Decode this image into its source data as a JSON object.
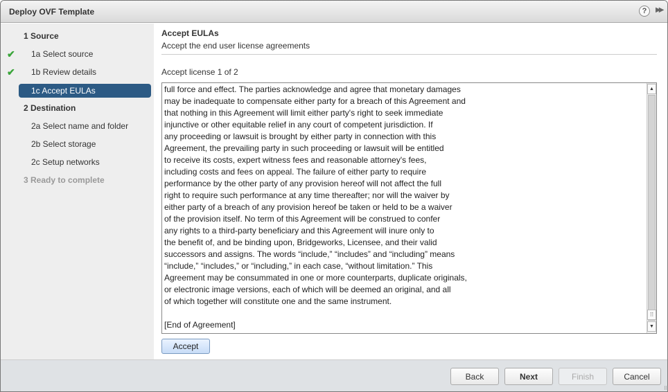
{
  "window": {
    "title": "Deploy OVF Template",
    "help_icon": "?",
    "expand_icon": "▶▶"
  },
  "sidebar": {
    "steps": [
      {
        "label": "1  Source",
        "type": "header"
      },
      {
        "label": "1a  Select source",
        "done": true
      },
      {
        "label": "1b  Review details",
        "done": true
      },
      {
        "label": "1c  Accept EULAs",
        "selected": true
      },
      {
        "label": "2  Destination",
        "type": "header"
      },
      {
        "label": "2a  Select name and folder"
      },
      {
        "label": "2b  Select storage"
      },
      {
        "label": "2c  Setup networks"
      },
      {
        "label": "3  Ready to complete",
        "type": "header",
        "disabled": true
      }
    ]
  },
  "main": {
    "title": "Accept EULAs",
    "subtitle": "Accept the end user license agreements",
    "license_counter": "Accept license 1 of 2",
    "eula_text": "full force and effect. The parties acknowledge and agree that monetary damages\nmay be inadequate to compensate either party for a breach of this Agreement and\nthat nothing in this Agreement will limit either party's right to seek immediate\ninjunctive or other equitable relief in any court of competent jurisdiction. If\nany proceeding or lawsuit is brought by either party in connection with this\nAgreement, the prevailing party in such proceeding or lawsuit will be entitled\nto receive its costs, expert witness fees and reasonable attorney's fees,\nincluding costs and fees on appeal. The failure of either party to require\nperformance by the other party of any provision hereof will not affect the full\nright to require such performance at any time thereafter; nor will the waiver by\neither party of a breach of any provision hereof be taken or held to be a waiver\nof the provision itself. No term of this Agreement will be construed to confer\nany rights to a third-party beneficiary and this Agreement will inure only to\nthe benefit of, and be binding upon, Bridgeworks, Licensee, and their valid\nsuccessors and assigns. The words “include,” “includes” and “including” means\n“include,” “includes,” or “including,” in each case, “without limitation.” This\nAgreement may be consummated in one or more counterparts, duplicate originals,\nor electronic image versions, each of which will be deemed an original, and all\nof which together will constitute one and the same instrument.\n\n[End of Agreement]",
    "accept_label": "Accept"
  },
  "footer": {
    "back": "Back",
    "next": "Next",
    "finish": "Finish",
    "cancel": "Cancel"
  },
  "colors": {
    "selected_step": "#2c5a84",
    "check": "#3aa53a"
  }
}
